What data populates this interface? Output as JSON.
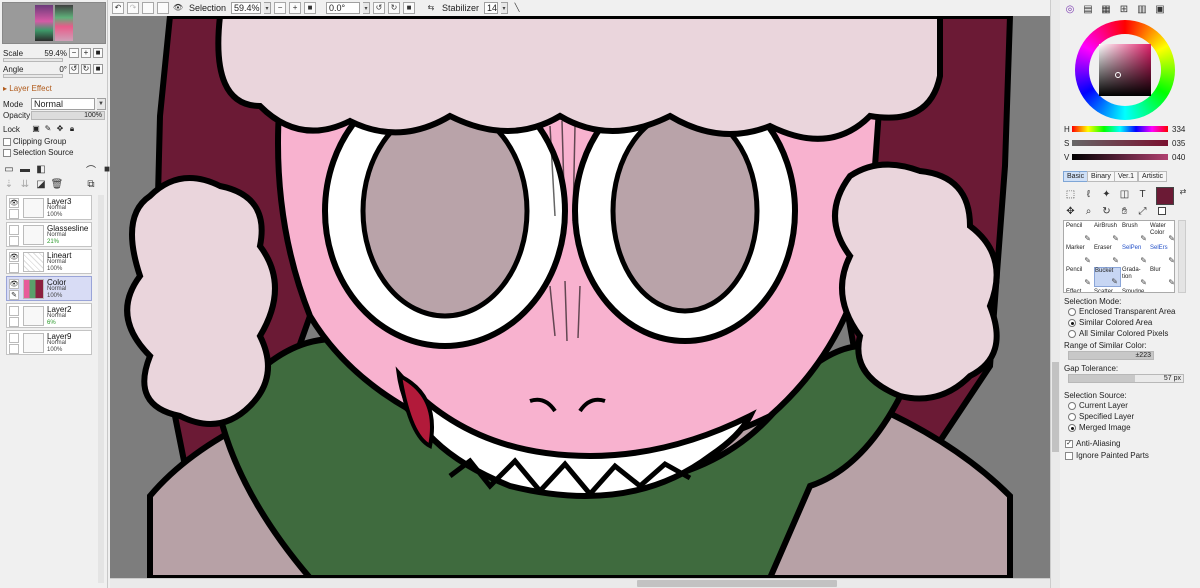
{
  "toolbar": {
    "selection_label": "Selection",
    "zoom_value": "59.4%",
    "rotation_value": "0.0°",
    "stabilizer_label": "Stabilizer",
    "stabilizer_value": "14"
  },
  "navigator": {
    "scale_label": "Scale",
    "scale_value": "59.4%",
    "angle_label": "Angle",
    "angle_value": "0°"
  },
  "layer_panel": {
    "effect_label": "Layer Effect",
    "mode_label": "Mode",
    "mode_value": "Normal",
    "opacity_label": "Opacity",
    "opacity_value": "100%",
    "lock_label": "Lock",
    "clipping_label": "Clipping Group",
    "selection_source_label": "Selection Source",
    "layers": [
      {
        "name": "Layer3",
        "mode": "Normal",
        "opacity": "100%"
      },
      {
        "name": "Glassesline",
        "mode": "Normal",
        "opacity": "21%"
      },
      {
        "name": "Lineart",
        "mode": "Normal",
        "opacity": "100%"
      },
      {
        "name": "Color",
        "mode": "Normal",
        "opacity": "100%"
      },
      {
        "name": "Layer2",
        "mode": "Normal",
        "opacity": "6%"
      },
      {
        "name": "Layer9",
        "mode": "Normal",
        "opacity": "100%"
      }
    ]
  },
  "color_panel": {
    "h_label": "H",
    "h_value": "334",
    "s_label": "S",
    "s_value": "035",
    "v_label": "V",
    "v_value": "040",
    "current_color": "#6b1a35"
  },
  "tool_tabs": [
    "Basic",
    "Binary",
    "Ver.1",
    "Artistic"
  ],
  "brushes": [
    {
      "name": "Pencil",
      "blue": false
    },
    {
      "name": "AirBrush",
      "blue": false
    },
    {
      "name": "Brush",
      "blue": false
    },
    {
      "name": "Water Color",
      "blue": false
    },
    {
      "name": "Marker",
      "blue": false
    },
    {
      "name": "Eraser",
      "blue": false
    },
    {
      "name": "SelPen",
      "blue": true
    },
    {
      "name": "SelErs",
      "blue": true
    },
    {
      "name": "Pencil",
      "blue": false
    },
    {
      "name": "Bucket",
      "blue": false
    },
    {
      "name": "Grada-tion",
      "blue": false
    },
    {
      "name": "Blur",
      "blue": false
    },
    {
      "name": "Effect",
      "blue": false
    },
    {
      "name": "Scatter",
      "blue": false
    },
    {
      "name": "Smudge",
      "blue": false
    }
  ],
  "bucket_options": {
    "selection_mode_label": "Selection Mode:",
    "modes": [
      "Enclosed Transparent Area",
      "Similar Colored Area",
      "All Similar Colored Pixels"
    ],
    "selected_mode": 1,
    "range_label": "Range of Similar Color:",
    "range_value": "±223",
    "gap_label": "Gap Tolerance:",
    "gap_value": "57 px",
    "source_label": "Selection Source:",
    "sources": [
      "Current Layer",
      "Specified Layer",
      "Merged Image"
    ],
    "selected_source": 2,
    "antialias_label": "Anti-Aliasing",
    "antialias_checked": true,
    "ignore_label": "Ignore Painted Parts",
    "ignore_checked": false
  }
}
